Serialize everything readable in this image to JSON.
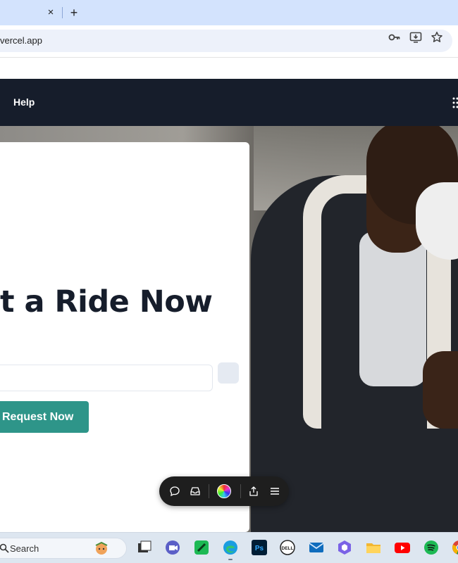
{
  "browser": {
    "tab_close": "×",
    "new_tab": "+",
    "url": "vercel.app",
    "icons": [
      "key-icon",
      "install-app-icon",
      "bookmark-star-icon"
    ]
  },
  "site": {
    "nav": {
      "help_label": "Help",
      "menu_icon": "grid-icon"
    },
    "hero": {
      "title": "t a Ride Now",
      "location_value": "",
      "request_button": "Request Now"
    }
  },
  "floating_toolbar": {
    "icons": [
      "comment-icon",
      "inbox-icon",
      "color-orb-icon",
      "share-icon",
      "menu-icon"
    ]
  },
  "taskbar": {
    "search_label": "Search",
    "apps": [
      "task-view",
      "teams",
      "notes",
      "edge",
      "photoshop",
      "dell",
      "mail",
      "copilot",
      "file-explorer",
      "youtube",
      "spotify",
      "chrome"
    ]
  },
  "colors": {
    "nav_bg": "#161d2b",
    "accent": "#2e9589",
    "tab_strip": "#d3e3fd"
  }
}
